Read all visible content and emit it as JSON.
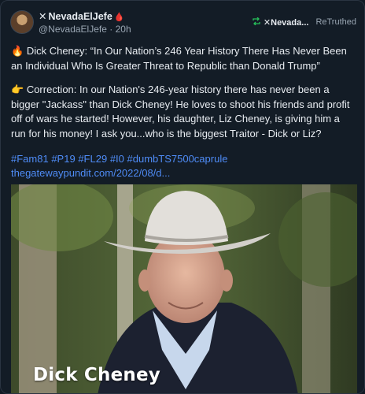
{
  "post": {
    "display_name": "NevadaElJefe",
    "display_prefix": "✕",
    "drop_emoji": "🩸",
    "handle": "@NevadaElJefe",
    "separator": "·",
    "age": "20h"
  },
  "retruth": {
    "icon": "retruth-icon",
    "name_prefix": "✕",
    "name": "Nevada...",
    "label": "ReTruthed"
  },
  "content": {
    "para1_emoji": "🔥",
    "para1": "Dick Cheney: “In Our Nation’s 246 Year History There Has Never Been an Individual Who Is Greater Threat to Republic than Donald Trump”",
    "para2_emoji": "👉",
    "para2": "Correction: In our Nation's 246-year history there has never been a bigger \"Jackass\" than Dick Cheney! He loves to shoot his friends and profit off of wars he started! However, his daughter, Liz Cheney, is giving him a run for his money! I ask you...who is the biggest Traitor - Dick or Liz?"
  },
  "tags": [
    "#Fam81",
    "#P19",
    "#FL29",
    "#I0",
    "#dumbTS7500caprule"
  ],
  "link": "thegatewaypundit.com/2022/08/d...",
  "media": {
    "caption": "Dick Cheney"
  },
  "colors": {
    "background": "#131c26",
    "link": "#4f8cf7",
    "retruth_icon": "#27c05a",
    "drop": "#e5424d"
  }
}
